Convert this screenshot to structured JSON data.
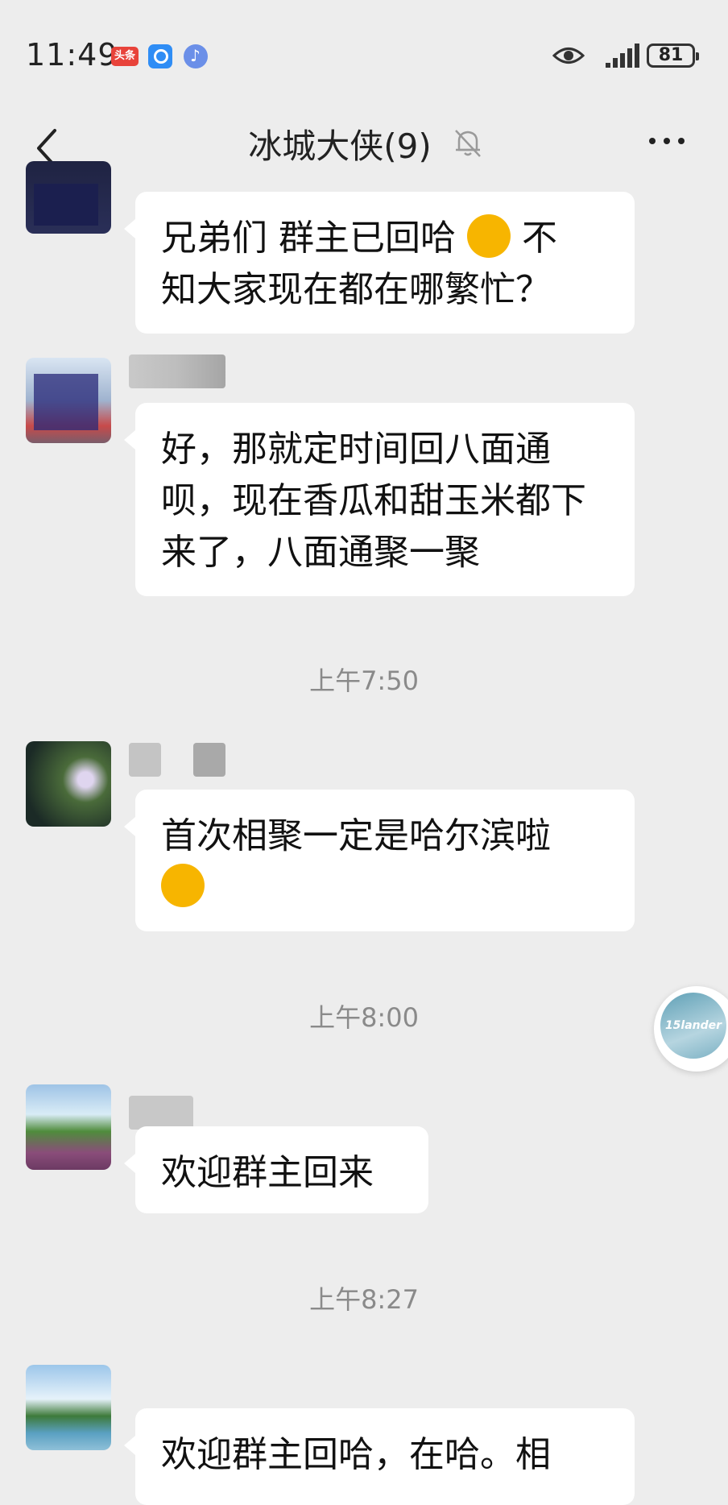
{
  "status_bar": {
    "time": "11:49",
    "toutiao_label": "头条",
    "battery": "81"
  },
  "header": {
    "title": "冰城大侠(9)"
  },
  "messages": [
    {
      "text_line1": "兄弟们 群主已回哈",
      "text_line2": "不",
      "text_line3": "知大家现在都在哪繁忙？",
      "emoji": "hand-over-mouth-emoji"
    },
    {
      "text": "好，那就定时间回八面通呗，现在香瓜和甜玉米都下来了，八面通聚一聚"
    },
    {
      "text": "首次相聚一定是哈尔滨啦",
      "emoji": "winking-tongue-emoji"
    },
    {
      "text": "欢迎群主回来"
    },
    {
      "text": "欢迎群主回哈，在哈。相"
    }
  ],
  "timestamps": [
    "上午7:50",
    "上午8:00",
    "上午8:27"
  ],
  "floating_badge": {
    "label": "15lander"
  },
  "colors": {
    "background": "#ededed",
    "bubble": "#ffffff",
    "timestamp": "#8a8a8a"
  }
}
